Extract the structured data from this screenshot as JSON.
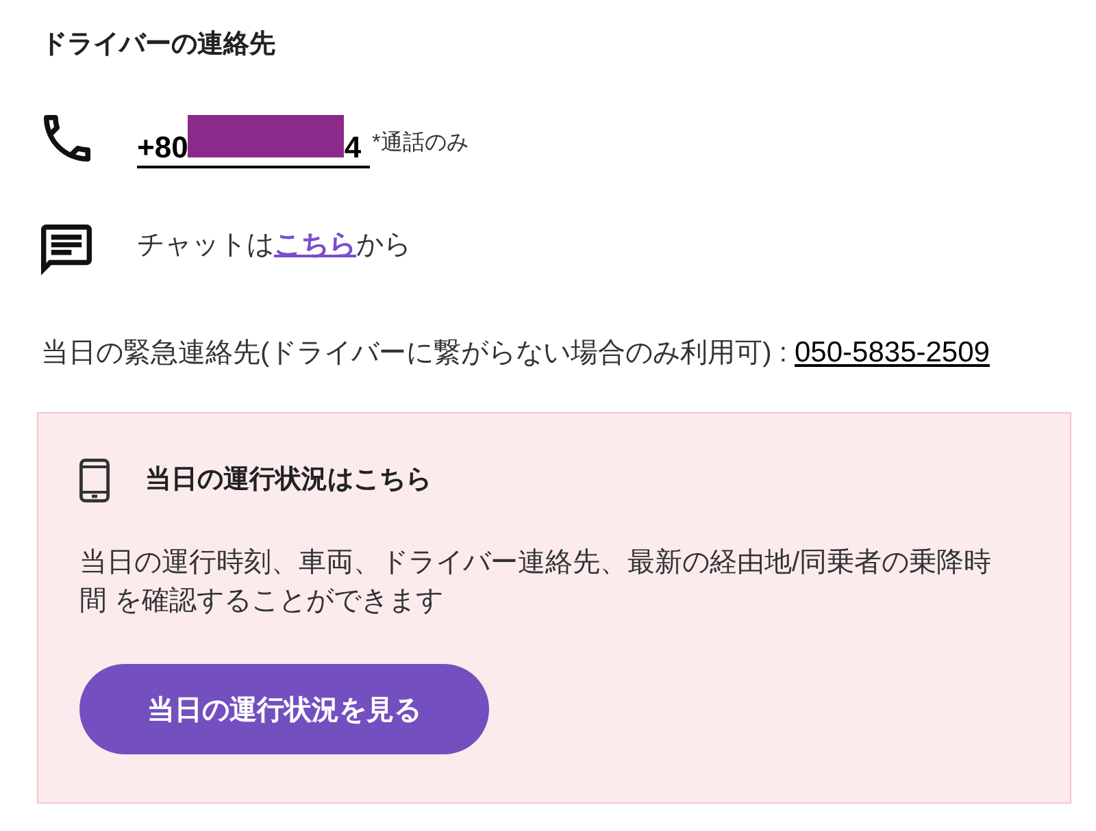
{
  "contacts": {
    "title": "ドライバーの連絡先",
    "phone": {
      "number_start": "+80",
      "redacted": true,
      "number_end": "4",
      "note": "*通話のみ"
    },
    "chat": {
      "text_before": "チャットは",
      "link": "こちら",
      "text_after": "から"
    },
    "emergency": {
      "label": "当日の緊急連絡先(ドライバーに繋がらない場合のみ利用可) :",
      "number": "050-5835-2509"
    }
  },
  "status_card": {
    "title": "当日の運行状況はこちら",
    "description": "当日の運行時刻、車両、ドライバー連絡先、最新の経由地/同乗者の乗降時間 を確認することができます",
    "button": "当日の運行状況を見る"
  }
}
